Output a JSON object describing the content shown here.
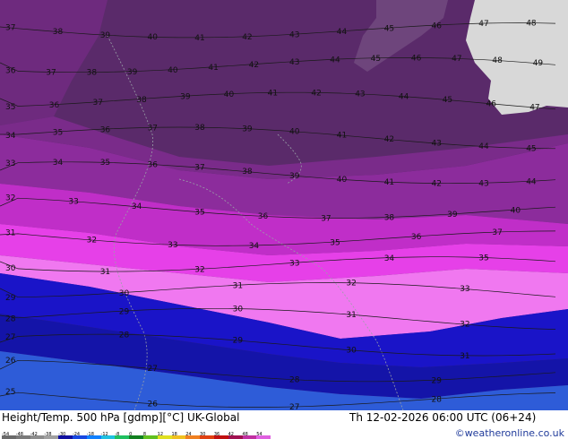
{
  "map": {
    "contour_labels": {
      "band_56_46": [
        "46",
        "45",
        "44",
        "43",
        "42",
        "41",
        "40",
        "39"
      ],
      "rows": [
        {
          "values": [
            "37",
            "38",
            "39",
            "40",
            "41",
            "42",
            "43",
            "44",
            "45",
            "46",
            "47",
            "48"
          ]
        },
        {
          "values": [
            "36",
            "37",
            "38",
            "39",
            "40",
            "41",
            "42",
            "43",
            "44",
            "45",
            "46",
            "47",
            "48",
            "49"
          ]
        },
        {
          "values": [
            "35",
            "36",
            "37",
            "38",
            "39",
            "40",
            "41",
            "42",
            "43",
            "44",
            "45",
            "46",
            "47"
          ]
        },
        {
          "values": [
            "34",
            "35",
            "36",
            "37",
            "38",
            "39",
            "40",
            "41",
            "42",
            "43",
            "44",
            "45"
          ]
        },
        {
          "values": [
            "33",
            "34",
            "35",
            "36",
            "37",
            "38",
            "39",
            "40",
            "41",
            "42",
            "43",
            "44"
          ]
        },
        {
          "values": [
            "32",
            "33",
            "34",
            "35",
            "36",
            "37",
            "38",
            "39",
            "40"
          ]
        },
        {
          "values": [
            "31",
            "32",
            "33",
            "34",
            "35",
            "36",
            "37"
          ]
        },
        {
          "values": [
            "30",
            "31",
            "32",
            "33",
            "34",
            "35"
          ]
        },
        {
          "values": [
            "29",
            "30",
            "31",
            "32",
            "33"
          ]
        },
        {
          "values": [
            "28",
            "29",
            "30",
            "31",
            "32"
          ]
        },
        {
          "values": [
            "27",
            "28",
            "29",
            "30",
            "31"
          ]
        },
        {
          "values": [
            "26",
            "27",
            "28",
            "29"
          ]
        },
        {
          "values": [
            "25",
            "26",
            "27",
            "28"
          ]
        }
      ]
    },
    "colors": {
      "band_45_plus": "#5a2a6a",
      "band_42_45": "#6e2a7e",
      "band_38_42": "#8c2c9c",
      "band_34_38": "#c02ec8",
      "band_32_34": "#e640e8",
      "band_30_32": "#f078f0",
      "band_28_30": "#1a14c8",
      "band_26_28": "#1414a8",
      "band_24_26": "#2e5cd8",
      "land": "#d8d8d8"
    }
  },
  "footer": {
    "title": "Height/Temp. 500 hPa [gdmp][°C] UK-Global",
    "datetime": "Th 12-02-2026 06:00 UTC (06+24)",
    "credit": "©weatheronline.co.uk",
    "scale_labels": [
      "-54",
      "-48",
      "-42",
      "-38",
      "-30",
      "-24",
      "-18",
      "-12",
      "-8",
      "0",
      "8",
      "12",
      "18",
      "24",
      "30",
      "36",
      "42",
      "48",
      "54"
    ],
    "scale_colors": [
      "#6a6a6a",
      "#7a7a7a",
      "#8c8c8c",
      "#a0a0a0",
      "#1010a0",
      "#1848e0",
      "#1080ff",
      "#20c0e0",
      "#20c060",
      "#108020",
      "#60c020",
      "#e0e020",
      "#f0c020",
      "#f08020",
      "#e04010",
      "#c01010",
      "#a01050",
      "#c030a0",
      "#e060e0"
    ]
  }
}
